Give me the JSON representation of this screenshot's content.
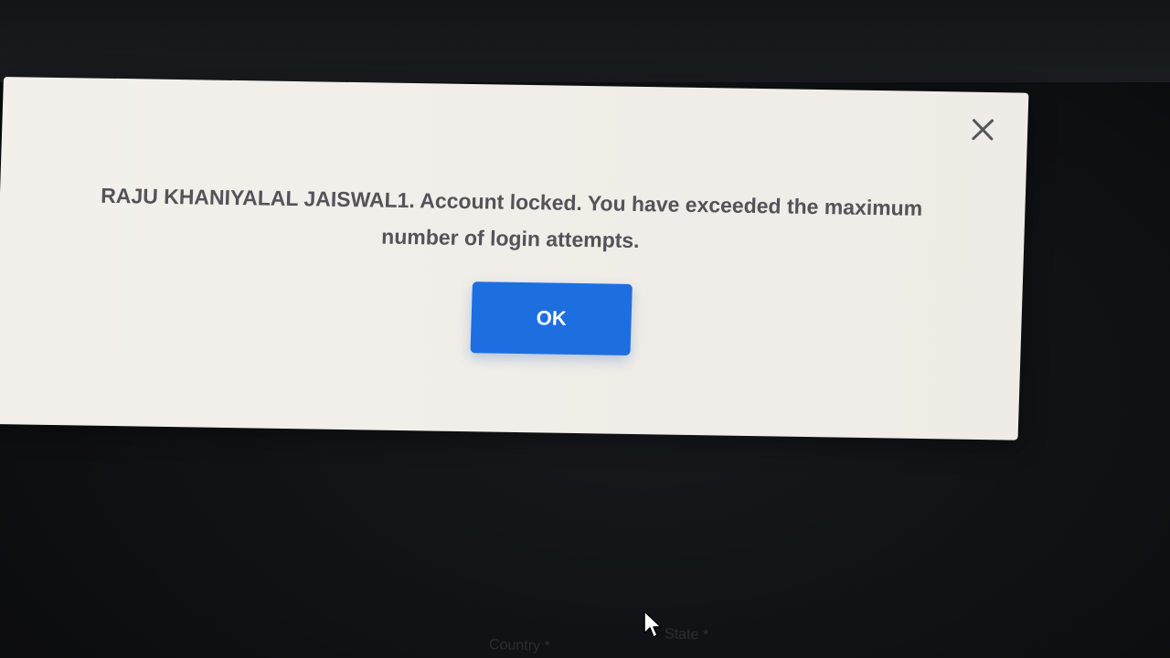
{
  "dialog": {
    "message": "RAJU KHANIYALAL JAISWAL1. Account locked. You have exceeded the maximum number of login attempts.",
    "ok_label": "OK",
    "close_icon": "close-icon"
  },
  "background_form": {
    "country_label": "Country *",
    "state_label": "State *"
  },
  "colors": {
    "button": "#1d6fe0",
    "dialog_background": "#f1eee9",
    "message_text": "#555359",
    "page_background": "#15171b"
  }
}
